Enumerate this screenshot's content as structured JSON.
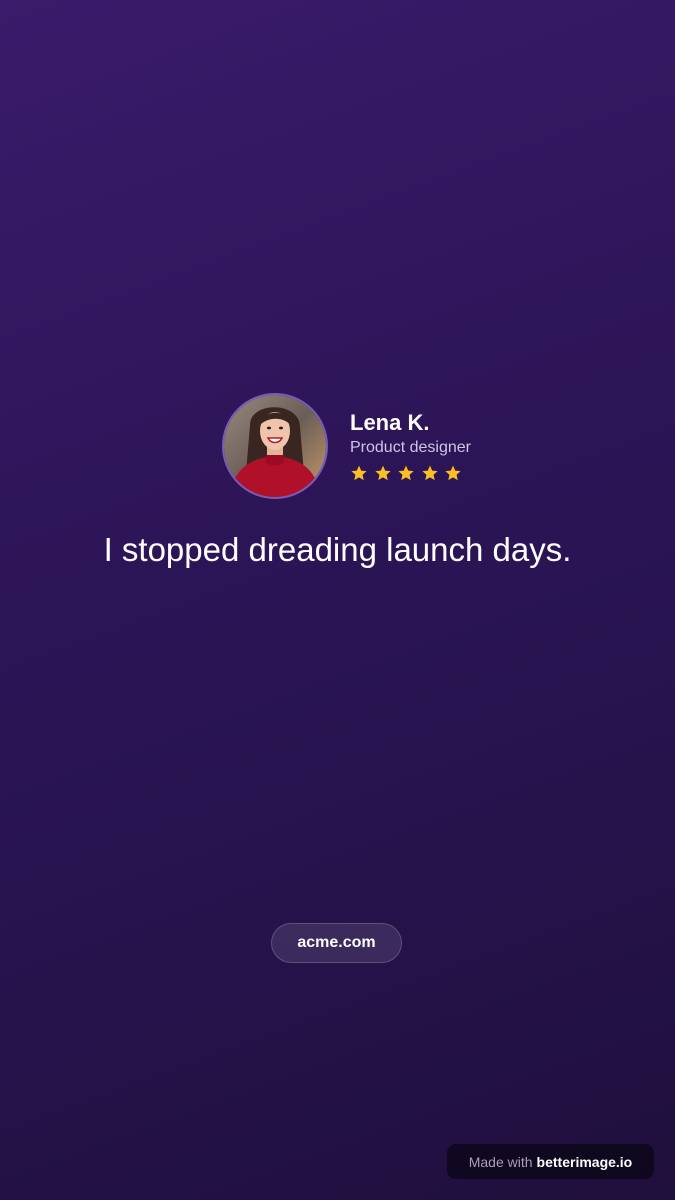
{
  "testimonial": {
    "author_name": "Lena K.",
    "author_role": "Product designer",
    "rating": 5,
    "rating_max": 5,
    "quote": "I stopped dreading launch days."
  },
  "footer": {
    "domain": "acme.com"
  },
  "watermark": {
    "prefix": "Made with",
    "brand": "betterimage.io"
  },
  "colors": {
    "background_top": "#3a1b6b",
    "background_bottom": "#1f0f3c",
    "star": "#fbbf24",
    "avatar_ring": "#7a5bb8"
  }
}
